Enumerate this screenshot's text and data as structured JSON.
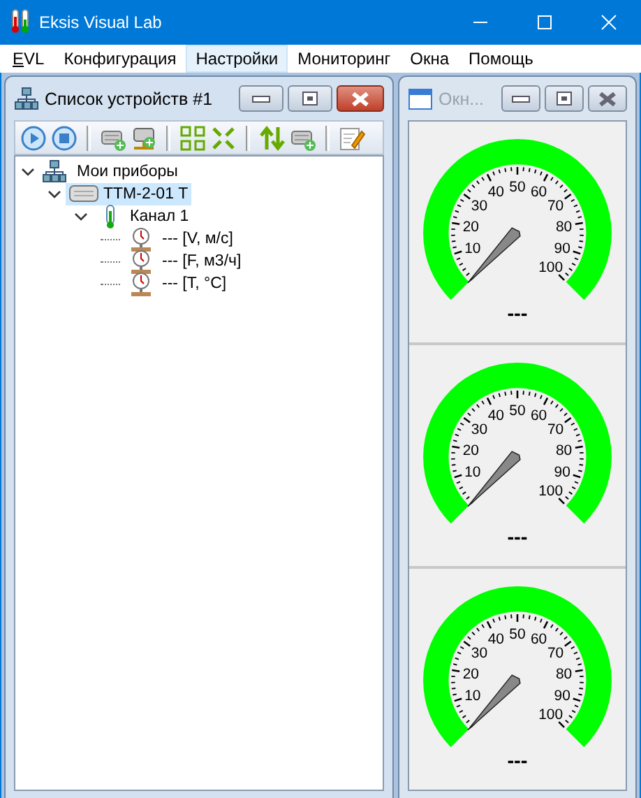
{
  "window": {
    "title": "Eksis Visual Lab"
  },
  "menu": [
    {
      "label": "EVL",
      "selected": false
    },
    {
      "label": "Конфигурация",
      "selected": false
    },
    {
      "label": "Настройки",
      "selected": true
    },
    {
      "label": "Мониторинг",
      "selected": false
    },
    {
      "label": "Окна",
      "selected": false
    },
    {
      "label": "Помощь",
      "selected": false
    }
  ],
  "device_window": {
    "title": "Список устройств #1",
    "active": true,
    "toolbar": [
      {
        "kind": "play"
      },
      {
        "kind": "stop"
      },
      {
        "kind": "separator"
      },
      {
        "kind": "add-device"
      },
      {
        "kind": "add-network"
      },
      {
        "kind": "separator"
      },
      {
        "kind": "expand"
      },
      {
        "kind": "collapse"
      },
      {
        "kind": "separator"
      },
      {
        "kind": "sort"
      },
      {
        "kind": "add-device"
      },
      {
        "kind": "separator"
      },
      {
        "kind": "edit"
      }
    ],
    "tree": [
      {
        "label": "Мои приборы",
        "kind": "group",
        "expanded": true,
        "selected": false,
        "children": [
          {
            "label": "ТТМ-2-01 Т",
            "kind": "device",
            "expanded": true,
            "selected": true,
            "children": [
              {
                "label": "Канал 1",
                "kind": "channel",
                "expanded": true,
                "selected": false,
                "children": [
                  {
                    "label": "--- [V, м/с]",
                    "kind": "sensor",
                    "selected": false
                  },
                  {
                    "label": "--- [F, м3/ч]",
                    "kind": "sensor",
                    "selected": false
                  },
                  {
                    "label": "--- [T, °C]",
                    "kind": "sensor",
                    "selected": false
                  }
                ]
              }
            ]
          }
        ]
      }
    ]
  },
  "gauge_window": {
    "title": "Окн...",
    "active": false,
    "gauges": [
      {
        "reading": "---",
        "scale": [
          "50",
          "40",
          "60",
          "30",
          "70",
          "20",
          "80",
          "10",
          "90",
          "100"
        ]
      },
      {
        "reading": "---",
        "scale": [
          "50",
          "40",
          "60",
          "30",
          "70",
          "20",
          "80",
          "10",
          "90",
          "100"
        ]
      },
      {
        "reading": "---",
        "scale": [
          "50",
          "40",
          "60",
          "30",
          "70",
          "20",
          "80",
          "10",
          "90",
          "100"
        ]
      }
    ]
  }
}
